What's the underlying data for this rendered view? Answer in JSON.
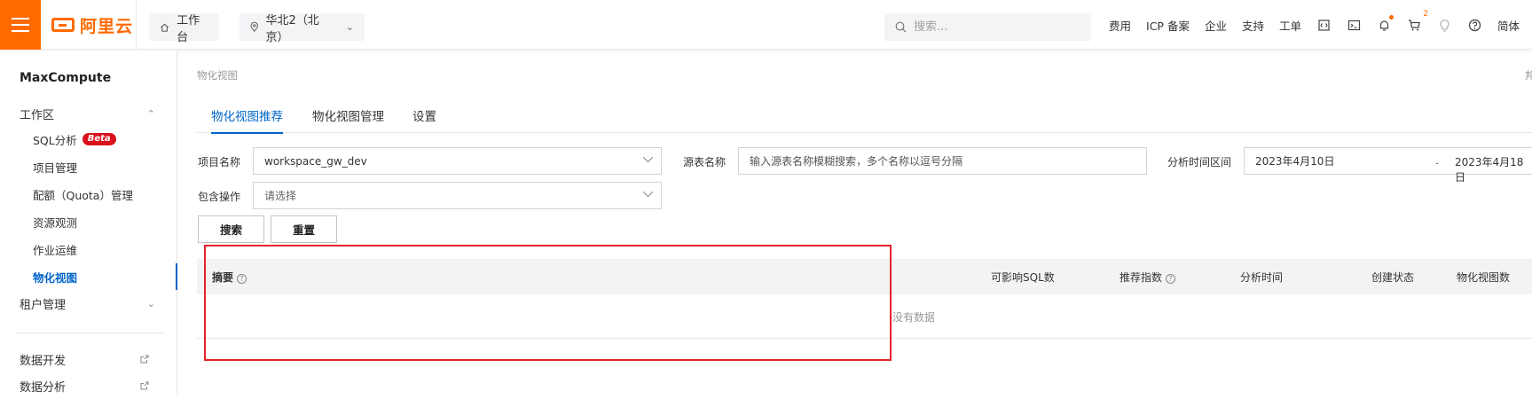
{
  "header": {
    "logo_text": "阿里云",
    "workbench_label": "工作台",
    "region_label": "华北2（北京）",
    "search_placeholder": "搜索...",
    "nav_links": [
      "费用",
      "ICP 备案",
      "企业",
      "支持",
      "工单"
    ],
    "cart_count": "2",
    "lang_label": "简体",
    "brand_color": "#ff6a00"
  },
  "sidebar": {
    "title": "MaxCompute",
    "workspace_group": "工作区",
    "workspace_items": [
      "SQL分析",
      "项目管理",
      "配额（Quota）管理",
      "资源观测",
      "作业运维",
      "物化视图"
    ],
    "beta_label": "Beta",
    "tenant_group": "租户管理",
    "external_items": [
      "数据开发",
      "数据分析"
    ],
    "active_item": "物化视图",
    "active_color": "#0064c8"
  },
  "main": {
    "breadcrumb": "物化视图",
    "corner_char": "邦",
    "tabs": [
      "物化视图推荐",
      "物化视图管理",
      "设置"
    ],
    "active_tab": "物化视图推荐",
    "filters": {
      "project_label": "项目名称",
      "project_value": "workspace_gw_dev",
      "source_label": "源表名称",
      "source_placeholder": "输入源表名称模糊搜索，多个名称以逗号分隔",
      "range_label": "分析时间区间",
      "date_start": "2023年4月10日",
      "date_sep": "-",
      "date_end": "2023年4月18日",
      "op_label": "包含操作",
      "op_placeholder": "请选择"
    },
    "buttons": {
      "search": "搜索",
      "reset": "重置"
    },
    "table": {
      "columns": [
        "摘要",
        "可影响SQL数",
        "推荐指数",
        "分析时间",
        "创建状态",
        "物化视图数"
      ],
      "empty_text": "没有数据"
    },
    "highlight_color": "#e5242a"
  }
}
